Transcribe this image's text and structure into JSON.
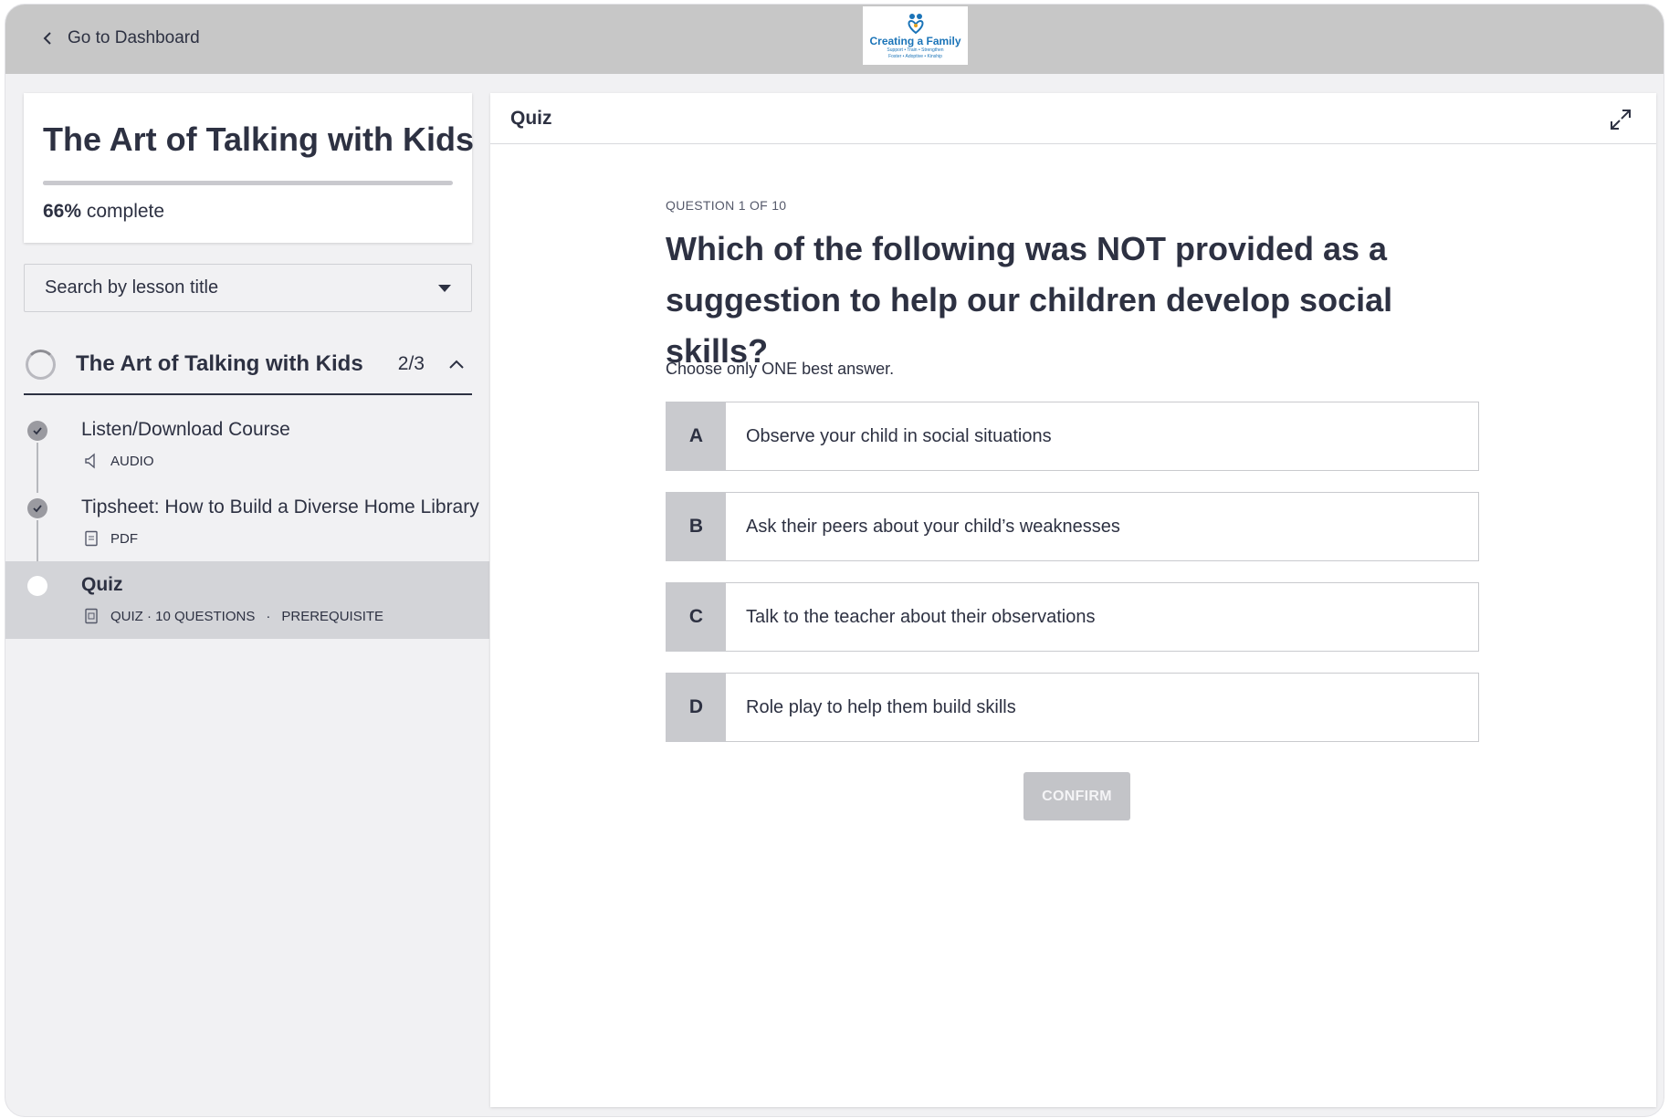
{
  "header": {
    "back_label": "Go to Dashboard",
    "logo_name": "Creating a Family",
    "logo_tagline_1": "Support • Train • Strengthen",
    "logo_tagline_2": "Foster • Adoptive • Kinship"
  },
  "sidebar": {
    "course_title": "The Art of Talking with Kids",
    "progress_percent": 66,
    "progress_value": "66%",
    "progress_suffix": " complete",
    "search_placeholder": "Search by lesson title",
    "section": {
      "title": "The Art of Talking with Kids",
      "count": "2/3"
    },
    "lessons": [
      {
        "title": "Listen/Download Course",
        "meta": "AUDIO",
        "icon": "speaker-icon",
        "status": "complete"
      },
      {
        "title": "Tipsheet: How to Build a Diverse Home Library",
        "meta": "PDF",
        "icon": "pdf-icon",
        "status": "complete"
      },
      {
        "title": "Quiz",
        "meta": "QUIZ · 10 QUESTIONS",
        "meta_extra": "PREREQUISITE",
        "icon": "quiz-icon",
        "status": "current"
      }
    ]
  },
  "main": {
    "panel_title": "Quiz",
    "question_counter": "QUESTION 1 OF 10",
    "question_text": "Which of the following was NOT provided as a suggestion to help our children develop social skills?",
    "instruction": "Choose only ONE best answer.",
    "answers": [
      {
        "letter": "A",
        "text": "Observe your child in social situations"
      },
      {
        "letter": "B",
        "text": "Ask their peers about your child’s weaknesses"
      },
      {
        "letter": "C",
        "text": "Talk to the teacher about their observations"
      },
      {
        "letter": "D",
        "text": "Role play to help them build skills"
      }
    ],
    "confirm_label": "CONFIRM"
  },
  "colors": {
    "header_bg": "#c7c7c7",
    "text": "#2d3142",
    "active_lesson_bg": "#d3d4d8",
    "answer_letter_bg": "#c9cace",
    "confirm_disabled": "#c3c4c8",
    "logo_blue": "#1b74b8"
  }
}
